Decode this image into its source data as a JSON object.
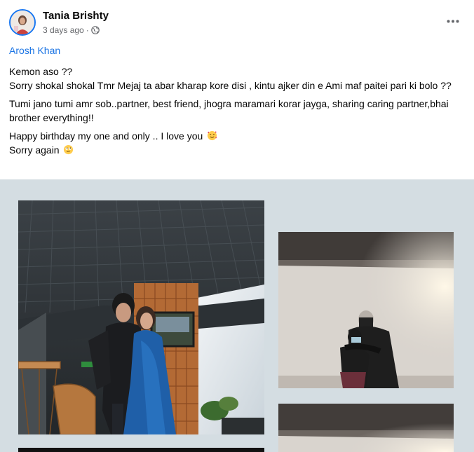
{
  "post": {
    "author_name": "Tania Brishty",
    "timestamp": "3 days ago",
    "separator": "·",
    "privacy_icon": "globe-icon",
    "more_icon": "more-options-icon",
    "tagged_name": "Arosh Khan",
    "body": {
      "line1": "Kemon aso ??",
      "line2": "Sorry shokal shokal Tmr Mejaj ta abar kharap kore disi , kintu ajker din e Ami maf paitei pari ki bolo ??",
      "para2": "Tumi jano tumi amr sob..partner, best friend, jhogra maramari korar jayga, sharing caring partner,bhai brother everything!!",
      "para3_line1": "Happy birthday my one and only .. I love you",
      "para3_line2": "Sorry again",
      "emoji1": "smiling-face-with-hearts-emoji",
      "emoji2": "face-with-rolling-eyes-emoji"
    },
    "photos": [
      {
        "name": "photo-couple-restaurant",
        "icon": "photo"
      },
      {
        "name": "photo-hug-room",
        "icon": "photo"
      },
      {
        "name": "photo-room-ceiling",
        "icon": "photo"
      },
      {
        "name": "photo-dark-bottom",
        "icon": "photo"
      }
    ]
  },
  "colors": {
    "link": "#1b74e4",
    "text": "#050505",
    "muted": "#65676b",
    "media_bg": "#d4dde2"
  }
}
